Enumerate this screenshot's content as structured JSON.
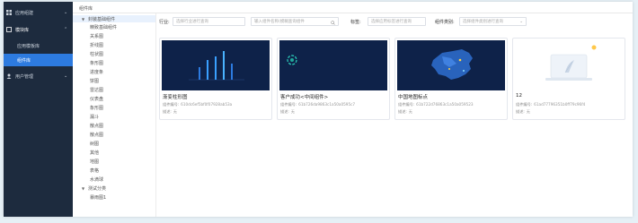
{
  "nav": {
    "items": [
      {
        "label": "应用组建",
        "icon": "grid-icon",
        "expanded": false
      },
      {
        "label": "模块库",
        "icon": "cube-icon",
        "expanded": true
      },
      {
        "label": "应用模板库",
        "sub": true
      },
      {
        "label": "组件库",
        "sub": true,
        "active": true
      },
      {
        "label": "用户管理",
        "icon": "user-icon",
        "expanded": false
      }
    ]
  },
  "breadcrumb": "组件库",
  "tree": {
    "items": [
      {
        "label": "封装基础组件",
        "type": "group",
        "selected": true
      },
      {
        "label": "精致基础组件",
        "type": "leaf"
      },
      {
        "label": "关系图",
        "type": "leaf"
      },
      {
        "label": "折线图",
        "type": "leaf"
      },
      {
        "label": "柱状图",
        "type": "leaf"
      },
      {
        "label": "条形图",
        "type": "leaf"
      },
      {
        "label": "进度条",
        "type": "leaf"
      },
      {
        "label": "饼图",
        "type": "leaf"
      },
      {
        "label": "雷达图",
        "type": "leaf"
      },
      {
        "label": "仪表盘",
        "type": "leaf"
      },
      {
        "label": "象形图",
        "type": "leaf"
      },
      {
        "label": "漏斗",
        "type": "leaf"
      },
      {
        "label": "散点图",
        "type": "leaf"
      },
      {
        "label": "散点图",
        "type": "leaf"
      },
      {
        "label": "树图",
        "type": "leaf"
      },
      {
        "label": "其他",
        "type": "leaf"
      },
      {
        "label": "地图",
        "type": "leaf"
      },
      {
        "label": "表格",
        "type": "leaf"
      },
      {
        "label": "水滴球",
        "type": "leaf"
      },
      {
        "label": "测试分类",
        "type": "group"
      },
      {
        "label": "暴雨图1",
        "type": "leaf"
      }
    ]
  },
  "filters": {
    "industry_label": "行业:",
    "industry_placeholder": "选择行业进行查询",
    "search_placeholder": "输入组件名称(模糊查询组件",
    "tags_label": "标签:",
    "tags_placeholder": "选择应用标签进行查询",
    "type_label": "组件类别:",
    "type_placeholder": "选择组件类别进行查询"
  },
  "cards": [
    {
      "title": "渐变柱形图",
      "code_label": "组件编号:",
      "code": "610dc6ef5bf0f07928ab53a",
      "desc_label": "描述:",
      "desc": "无",
      "thumb": "bars"
    },
    {
      "title": "客户成功<中间组件>",
      "code_label": "组件编号:",
      "code": "61b726da9863c1a50a0595c7",
      "desc_label": "描述:",
      "desc": "无",
      "thumb": "ring"
    },
    {
      "title": "中国地图标点",
      "code_label": "组件编号:",
      "code": "61b722d76863c1a50a059523",
      "desc_label": "描述:",
      "desc": "无",
      "thumb": "map"
    },
    {
      "title": "12",
      "code_label": "组件编号:",
      "code": "61ad77796351b0ff79c96f4",
      "desc_label": "描述:",
      "desc": "无",
      "thumb": "empty"
    }
  ],
  "colors": {
    "nav_bg": "#1d2b3e",
    "active": "#2d7be0",
    "thumb_bg": "#0e2249"
  }
}
